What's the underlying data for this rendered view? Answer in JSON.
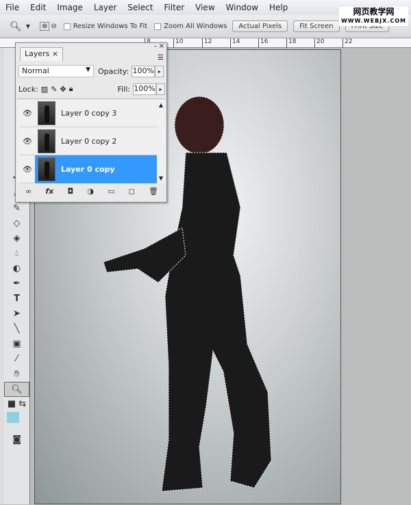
{
  "menu": [
    "File",
    "Edit",
    "Image",
    "Layer",
    "Select",
    "Filter",
    "View",
    "Window",
    "Help"
  ],
  "options": {
    "resize": "Resize Windows To Fit",
    "zoom_all": "Zoom All Windows",
    "actual": "Actual Pixels",
    "fit": "Fit Screen",
    "print": "Print Size"
  },
  "watermark": {
    "cn": "网页教学网",
    "url": "WWW.WEBJX.COM"
  },
  "ruler": [
    "8",
    "10",
    "12",
    "14",
    "16",
    "18",
    "20",
    "22"
  ],
  "layers": {
    "tab": "Layers",
    "close": "×",
    "blend": "Normal",
    "opacity_label": "Opacity:",
    "opacity": "100%",
    "lock_label": "Lock:",
    "fill_label": "Fill:",
    "fill": "100%",
    "items": [
      {
        "name": "Layer 0 copy 3",
        "selected": false
      },
      {
        "name": "Layer 0 copy 2",
        "selected": false
      },
      {
        "name": "Layer 0 copy",
        "selected": true
      }
    ]
  },
  "colors": {
    "selection": "#3399ff",
    "foreground": "#000000",
    "background_swatch": "#8fd0e0"
  }
}
